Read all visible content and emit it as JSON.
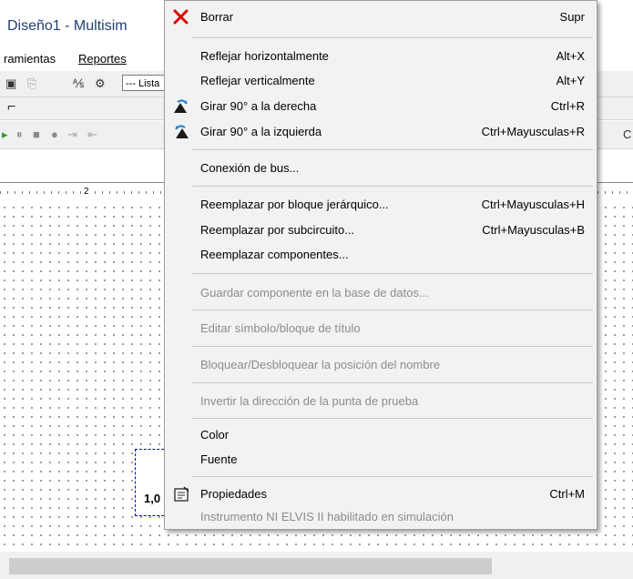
{
  "window": {
    "title": "Diseño1 - Multisim"
  },
  "menubar": {
    "items": [
      "ramientas",
      "Reportes"
    ]
  },
  "toolbar": {
    "list_field": "--- Lista"
  },
  "ruler": {
    "marker": "2"
  },
  "component": {
    "value": "1,0"
  },
  "context_menu": {
    "items": [
      {
        "label": "Borrar",
        "shortcut": "Supr",
        "icon": "delete-x-icon",
        "enabled": true
      },
      {
        "label": "Reflejar horizontalmente",
        "shortcut": "Alt+X",
        "enabled": true
      },
      {
        "label": "Reflejar verticalmente",
        "shortcut": "Alt+Y",
        "enabled": true
      },
      {
        "label": "Girar 90° a la derecha",
        "shortcut": "Ctrl+R",
        "icon": "rotate-right-icon",
        "enabled": true
      },
      {
        "label": "Girar 90° a la izquierda",
        "shortcut": "Ctrl+Mayusculas+R",
        "icon": "rotate-left-icon",
        "enabled": true
      },
      {
        "label": "Conexión de bus...",
        "shortcut": "",
        "enabled": true
      },
      {
        "label": "Reemplazar por bloque jerárquico...",
        "shortcut": "Ctrl+Mayusculas+H",
        "enabled": true
      },
      {
        "label": "Reemplazar por subcircuito...",
        "shortcut": "Ctrl+Mayusculas+B",
        "enabled": true
      },
      {
        "label": "Reemplazar componentes...",
        "shortcut": "",
        "enabled": true
      },
      {
        "label": "Guardar componente en la base de datos...",
        "shortcut": "",
        "enabled": false
      },
      {
        "label": "Editar símbolo/bloque de título",
        "shortcut": "",
        "enabled": false
      },
      {
        "label": "Bloquear/Desbloquear la posición del nombre",
        "shortcut": "",
        "enabled": false
      },
      {
        "label": "Invertir la dirección de la punta de prueba",
        "shortcut": "",
        "enabled": false
      },
      {
        "label": "Color",
        "shortcut": "",
        "enabled": true
      },
      {
        "label": "Fuente",
        "shortcut": "",
        "enabled": true
      },
      {
        "label": "Propiedades",
        "shortcut": "Ctrl+M",
        "icon": "properties-icon",
        "enabled": true
      },
      {
        "label": "Instrumento NI ELVIS II habilitado en simulación",
        "shortcut": "",
        "enabled": false
      }
    ]
  },
  "colors": {
    "delete_icon": "#e00000",
    "menu_bg": "#f2f2f2",
    "disabled_text": "#8c8c8c",
    "selection_border": "#0000cc"
  }
}
